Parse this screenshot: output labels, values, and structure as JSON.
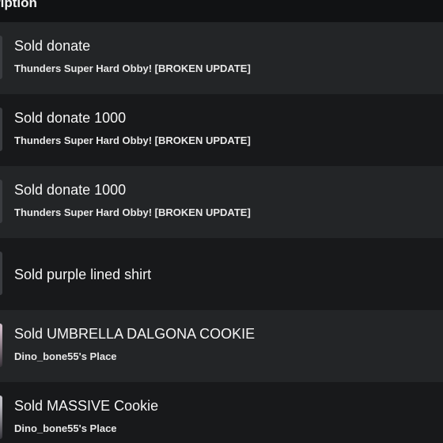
{
  "header": {
    "label": "ription"
  },
  "transactions": [
    {
      "prefix": "Sold",
      "item": "donate",
      "place": "Thunders Super Hard Obby! [BROKEN UPDATE]"
    },
    {
      "prefix": "Sold",
      "item": "donate 1000",
      "place": "Thunders Super Hard Obby! [BROKEN UPDATE]"
    },
    {
      "prefix": "Sold",
      "item": "donate 1000",
      "place": "Thunders Super Hard Obby! [BROKEN UPDATE]"
    },
    {
      "prefix": "Sold",
      "item": "purple lined shirt",
      "place": ""
    },
    {
      "prefix": "Sold",
      "item": "UMBRELLA DALGONA COOKIE",
      "place": "Dino_bone55's Place"
    },
    {
      "prefix": "Sold",
      "item": "MASSIVE Cookie",
      "place": "Dino_bone55's Place"
    }
  ]
}
